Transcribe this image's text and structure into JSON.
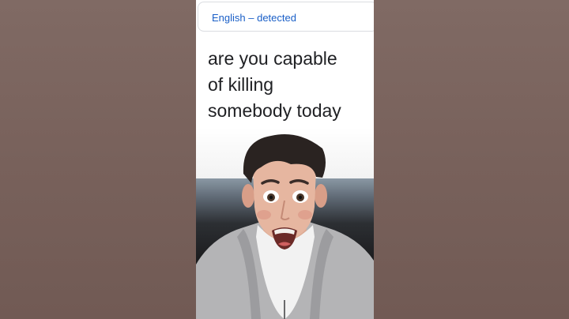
{
  "translator": {
    "detected_language": "English – detected",
    "source_lines": [
      "are you capable",
      "of killing",
      "somebody today"
    ]
  },
  "colors": {
    "detected_label": "#1a5fc7",
    "source_text": "#202124",
    "background": "#7a6560"
  }
}
